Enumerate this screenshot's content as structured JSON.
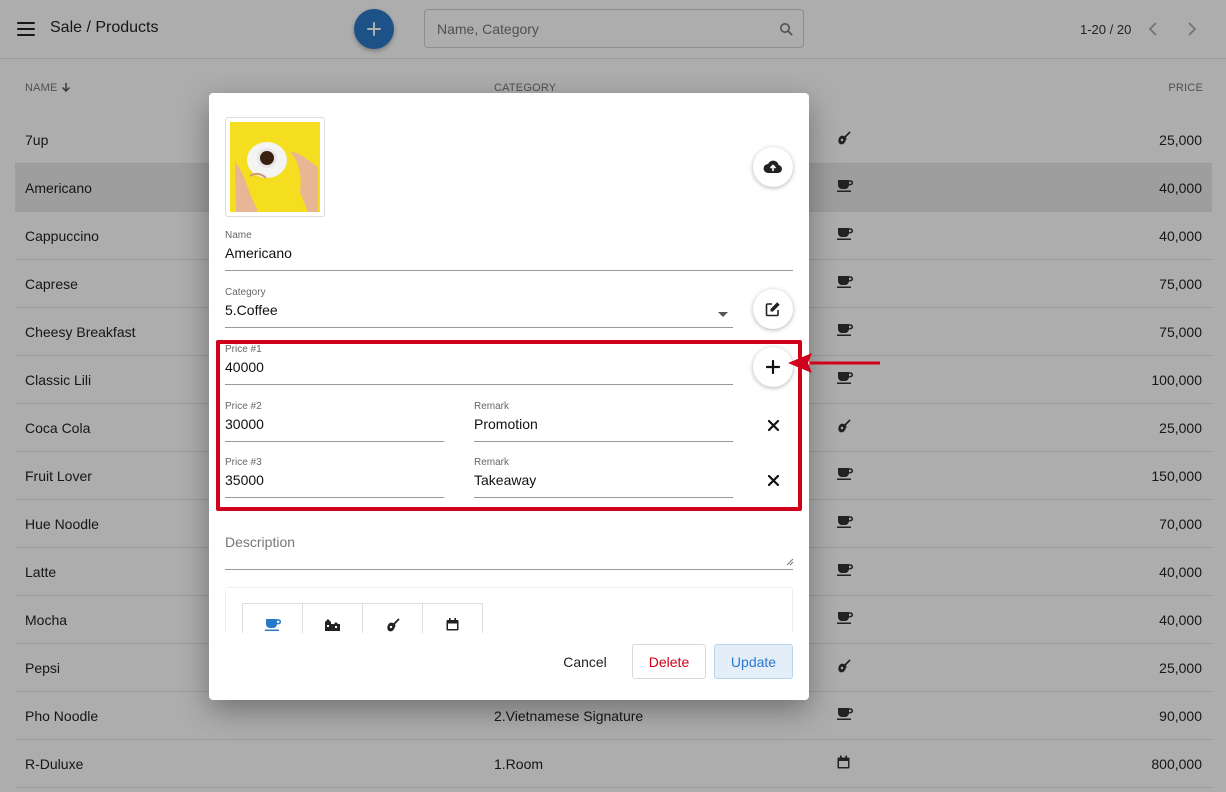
{
  "header": {
    "breadcrumb": "Sale / Products",
    "search_placeholder": "Name, Category",
    "pagination": "1-20 / 20"
  },
  "table": {
    "columns": {
      "name": "NAME",
      "category": "CATEGORY",
      "price": "PRICE"
    },
    "sort_indicator": "arrow-down-icon",
    "rows": [
      {
        "name": "7up",
        "category": "",
        "icon": "guitar-icon",
        "price": "25,000"
      },
      {
        "name": "Americano",
        "category": "",
        "icon": "cup-icon",
        "price": "40,000",
        "selected": true
      },
      {
        "name": "Cappuccino",
        "category": "",
        "icon": "cup-icon",
        "price": "40,000"
      },
      {
        "name": "Caprese",
        "category": "",
        "icon": "cup-icon",
        "price": "75,000"
      },
      {
        "name": "Cheesy Breakfast",
        "category": "",
        "icon": "cup-icon",
        "price": "75,000"
      },
      {
        "name": "Classic Lili",
        "category": "",
        "icon": "cup-icon",
        "price": "100,000"
      },
      {
        "name": "Coca Cola",
        "category": "",
        "icon": "guitar-icon",
        "price": "25,000"
      },
      {
        "name": "Fruit Lover",
        "category": "",
        "icon": "cup-icon",
        "price": "150,000"
      },
      {
        "name": "Hue Noodle",
        "category": "",
        "icon": "cup-icon",
        "price": "70,000"
      },
      {
        "name": "Latte",
        "category": "",
        "icon": "cup-icon",
        "price": "40,000"
      },
      {
        "name": "Mocha",
        "category": "",
        "icon": "cup-icon",
        "price": "40,000"
      },
      {
        "name": "Pepsi",
        "category": "",
        "icon": "guitar-icon",
        "price": "25,000"
      },
      {
        "name": "Pho Noodle",
        "category": "2.Vietnamese Signature",
        "icon": "cup-icon",
        "price": "90,000"
      },
      {
        "name": "R-Duluxe",
        "category": "1.Room",
        "icon": "calendar-icon",
        "price": "800,000"
      }
    ]
  },
  "modal": {
    "name_label": "Name",
    "name_value": "Americano",
    "category_label": "Category",
    "category_value": "5.Coffee",
    "prices": [
      {
        "label": "Price #1",
        "value": "40000"
      },
      {
        "label": "Price #2",
        "value": "30000",
        "remark_label": "Remark",
        "remark_value": "Promotion"
      },
      {
        "label": "Price #3",
        "value": "35000",
        "remark_label": "Remark",
        "remark_value": "Takeaway"
      }
    ],
    "description_placeholder": "Description",
    "icon_tabs": [
      "cup-icon",
      "building-icon",
      "guitar-icon",
      "calendar-icon"
    ],
    "buttons": {
      "cancel": "Cancel",
      "delete": "Delete",
      "update": "Update"
    }
  },
  "colors": {
    "accent": "#2a79c9",
    "danger": "#d0021b",
    "highlight_box": "#d0021b",
    "thumbnail_bg": "#f5dd1f"
  }
}
